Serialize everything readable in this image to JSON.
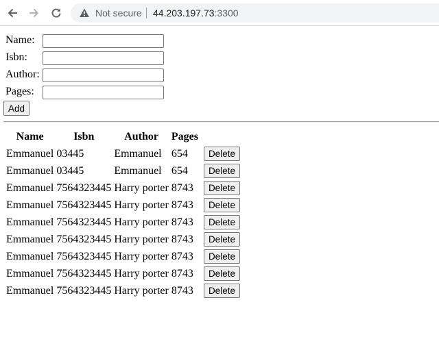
{
  "browser": {
    "security_label": "Not secure",
    "url_host": "44.203.197.73",
    "url_port": ":3300",
    "icons": {
      "back": "back-arrow-icon",
      "forward": "forward-arrow-icon",
      "reload": "reload-icon",
      "security": "warning-triangle-icon"
    }
  },
  "form": {
    "fields": [
      {
        "label": "Name:",
        "value": ""
      },
      {
        "label": "Isbn:",
        "value": ""
      },
      {
        "label": "Author:",
        "value": ""
      },
      {
        "label": "Pages:",
        "value": ""
      }
    ],
    "add_label": "Add"
  },
  "table": {
    "headers": [
      "Name",
      "Isbn",
      "Author",
      "Pages"
    ],
    "delete_label": "Delete",
    "rows": [
      {
        "name": "Emmanuel",
        "isbn": "03445",
        "author": "Emmanuel",
        "pages": "654"
      },
      {
        "name": "Emmanuel",
        "isbn": "03445",
        "author": "Emmanuel",
        "pages": "654"
      },
      {
        "name": "Emmanuel",
        "isbn": "7564323445",
        "author": "Harry porter",
        "pages": "8743"
      },
      {
        "name": "Emmanuel",
        "isbn": "7564323445",
        "author": "Harry porter",
        "pages": "8743"
      },
      {
        "name": "Emmanuel",
        "isbn": "7564323445",
        "author": "Harry porter",
        "pages": "8743"
      },
      {
        "name": "Emmanuel",
        "isbn": "7564323445",
        "author": "Harry porter",
        "pages": "8743"
      },
      {
        "name": "Emmanuel",
        "isbn": "7564323445",
        "author": "Harry porter",
        "pages": "8743"
      },
      {
        "name": "Emmanuel",
        "isbn": "7564323445",
        "author": "Harry porter",
        "pages": "8743"
      },
      {
        "name": "Emmanuel",
        "isbn": "7564323445",
        "author": "Harry porter",
        "pages": "8743"
      }
    ]
  }
}
